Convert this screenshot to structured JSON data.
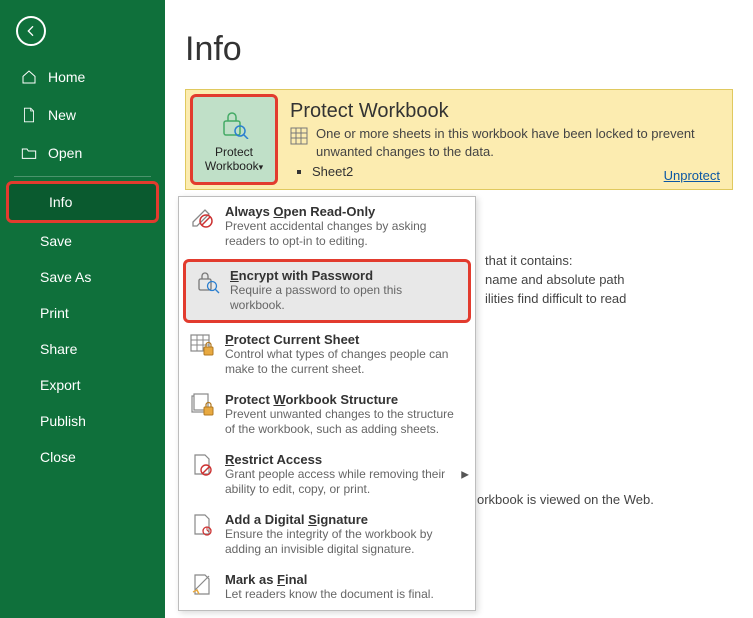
{
  "page_title": "Info",
  "sidebar": {
    "home": "Home",
    "new": "New",
    "open": "Open",
    "info": "Info",
    "save": "Save",
    "save_as": "Save As",
    "print": "Print",
    "share": "Share",
    "export": "Export",
    "publish": "Publish",
    "close": "Close"
  },
  "protect_box": {
    "btn_line1": "Protect",
    "btn_line2": "Workbook",
    "title": "Protect Workbook",
    "desc": "One or more sheets in this workbook have been locked to prevent unwanted changes to the data.",
    "sheet": "Sheet2",
    "unprotect": "Unprotect"
  },
  "menu": {
    "always_open": {
      "title": "Always Open Read-Only",
      "desc": "Prevent accidental changes by asking readers to opt-in to editing."
    },
    "encrypt": {
      "title": "Encrypt with Password",
      "desc": "Require a password to open this workbook."
    },
    "protect_sheet": {
      "title": "Protect Current Sheet",
      "desc": "Control what types of changes people can make to the current sheet."
    },
    "protect_structure": {
      "title": "Protect Workbook Structure",
      "desc": "Prevent unwanted changes to the structure of the workbook, such as adding sheets."
    },
    "restrict": {
      "title": "Restrict Access",
      "desc": "Grant people access while removing their ability to edit, copy, or print."
    },
    "signature": {
      "title": "Add a Digital Signature",
      "desc": "Ensure the integrity of the workbook by adding an invisible digital signature."
    },
    "mark_final": {
      "title": "Mark as Final",
      "desc": "Let readers know the document is final."
    }
  },
  "bg": {
    "inspect1": "that it contains:",
    "inspect2": "name and absolute path",
    "inspect3": "ilities find difficult to read",
    "browser_tail": "orkbook is viewed on the Web."
  }
}
